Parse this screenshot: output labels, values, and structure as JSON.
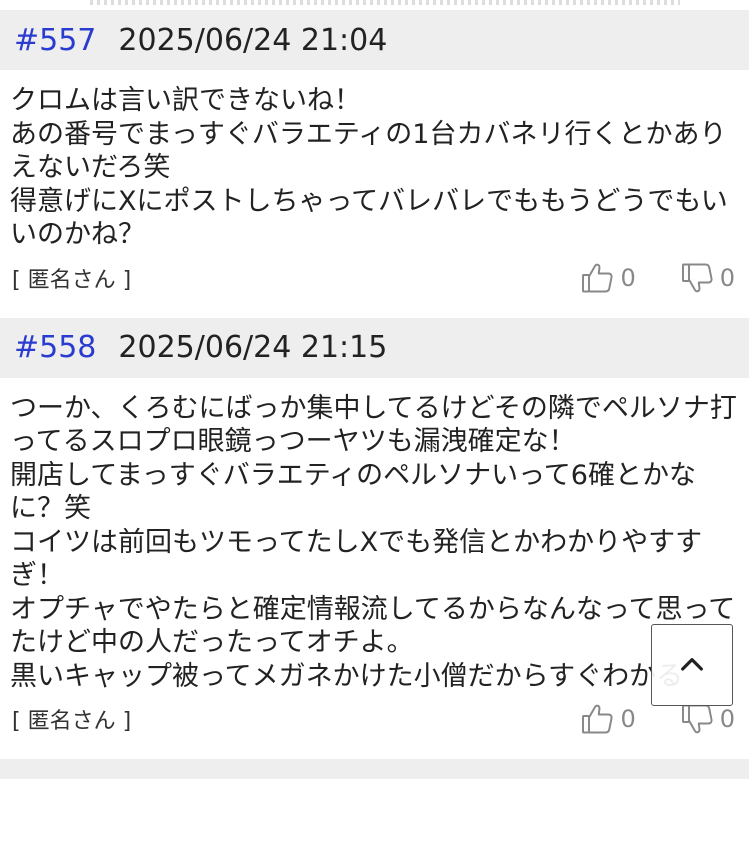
{
  "posts": [
    {
      "number": "#557",
      "datetime": "2025/06/24 21:04",
      "body": "クロムは言い訳できないね！\nあの番号でまっすぐバラエティの1台カバネリ行くとかありえないだろ笑\n得意げにXにポストしちゃってバレバレでももうどうでもいいのかね？",
      "author": "[ 匿名さん ]",
      "likes": "0",
      "dislikes": "0"
    },
    {
      "number": "#558",
      "datetime": "2025/06/24 21:15",
      "body": "つーか、くろむにばっか集中してるけどその隣でペルソナ打ってるスロプロ眼鏡っつーヤツも漏洩確定な！\n開店してまっすぐバラエティのペルソナいって6確とかなに？笑\nコイツは前回もツモってたしXでも発信とかわかりやすすぎ！\nオプチャでやたらと確定情報流してるからなんなって思ってたけど中の人だったってオチよ。\n黒いキャップ被ってメガネかけた小僧だからすぐわかる",
      "author": "[ 匿名さん ]",
      "likes": "0",
      "dislikes": "0"
    }
  ],
  "icons": {
    "like": "thumbs-up-icon",
    "dislike": "thumbs-down-icon",
    "scroll_top": "chevron-up-icon"
  },
  "colors": {
    "post_number": "#2a3bd0",
    "header_bg": "#eeeeee",
    "vote_count": "#888888"
  }
}
